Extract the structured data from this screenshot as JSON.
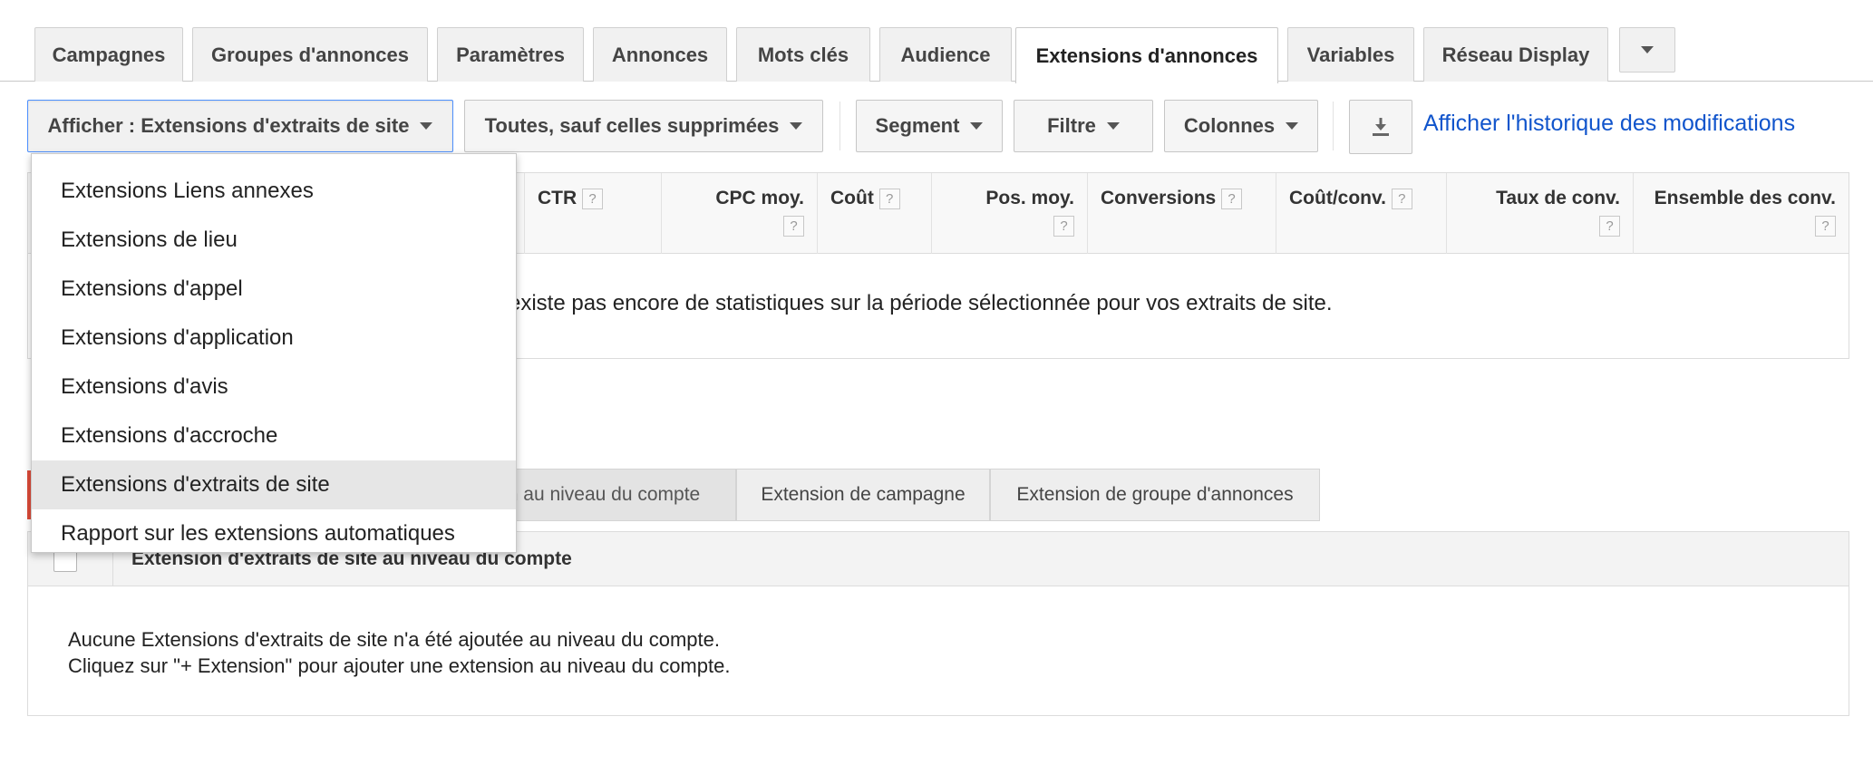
{
  "tabs": [
    {
      "label": "Campagnes"
    },
    {
      "label": "Groupes d'annonces"
    },
    {
      "label": "Paramètres"
    },
    {
      "label": "Annonces"
    },
    {
      "label": "Mots clés"
    },
    {
      "label": "Audience"
    },
    {
      "label": "Extensions d'annonces",
      "active": true
    },
    {
      "label": "Variables"
    },
    {
      "label": "Réseau Display"
    }
  ],
  "toolbar": {
    "view_dropdown": "Afficher : Extensions d'extraits de site",
    "status_dropdown": "Toutes, sauf celles supprimées",
    "segment": "Segment",
    "filter": "Filtre",
    "columns": "Colonnes",
    "download_icon": "download-icon",
    "history_link": "Afficher l'historique des modifications"
  },
  "view_menu": {
    "items": [
      "Extensions Liens annexes",
      "Extensions de lieu",
      "Extensions d'appel",
      "Extensions d'application",
      "Extensions d'avis",
      "Extensions d'accroche",
      "Extensions d'extraits de site",
      "Rapport sur les extensions automatiques"
    ],
    "selected_index": 6
  },
  "stats_table": {
    "columns": [
      "CTR",
      "CPC moy.",
      "Coût",
      "Pos. moy.",
      "Conversions",
      "Coût/conv.",
      "Taux de conv.",
      "Ensemble des conv."
    ],
    "help_glyph": "?",
    "empty_message": "existe pas encore de statistiques sur la période sélectionnée pour vos extraits de site."
  },
  "subtabs": [
    {
      "label": "n au niveau du compte",
      "active": true
    },
    {
      "label": "Extension de campagne"
    },
    {
      "label": "Extension de groupe d'annonces"
    }
  ],
  "extension_table": {
    "header": "Extension d'extraits de site au niveau du compte",
    "empty_line1": "Aucune Extensions d'extraits de site n'a été ajoutée au niveau du compte.",
    "empty_line2": "Cliquez sur \"+ Extension\" pour ajouter une extension au niveau du compte."
  },
  "colors": {
    "link": "#1155cc",
    "focus_border": "#4d90fe",
    "red_marker": "#dd4b39"
  }
}
